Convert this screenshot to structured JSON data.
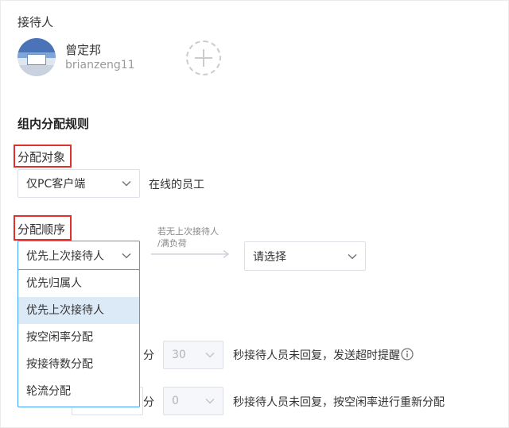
{
  "receiver": {
    "label": "接待人",
    "user": {
      "name": "曾定邦",
      "id": "brianzeng11"
    }
  },
  "group_rules": {
    "heading": "组内分配规则",
    "target": {
      "label": "分配对象",
      "selected": "仅PC客户端",
      "suffix": "在线的员工"
    },
    "order": {
      "label": "分配顺序",
      "selected": "优先上次接待人",
      "fallback_hint_line1": "若无上次接待人",
      "fallback_hint_line2": "/满负荷",
      "fallback_placeholder": "请选择",
      "options": [
        {
          "label": "优先归属人",
          "selected": false
        },
        {
          "label": "优先上次接待人",
          "selected": true
        },
        {
          "label": "按空闲率分配",
          "selected": false
        },
        {
          "label": "按接待数分配",
          "selected": false
        },
        {
          "label": "轮流分配",
          "selected": false
        }
      ]
    },
    "timeout_rows": [
      {
        "unit": "分",
        "seconds": "30",
        "text": "秒接待人员未回复，发送超时提醒"
      },
      {
        "unit": "分",
        "seconds": "0",
        "text": "秒接待人员未回复，按空闲率进行重新分配"
      }
    ]
  },
  "colors": {
    "highlight_border": "#e0302a",
    "accent": "#409eff",
    "selected_bg": "#dceaf8"
  }
}
